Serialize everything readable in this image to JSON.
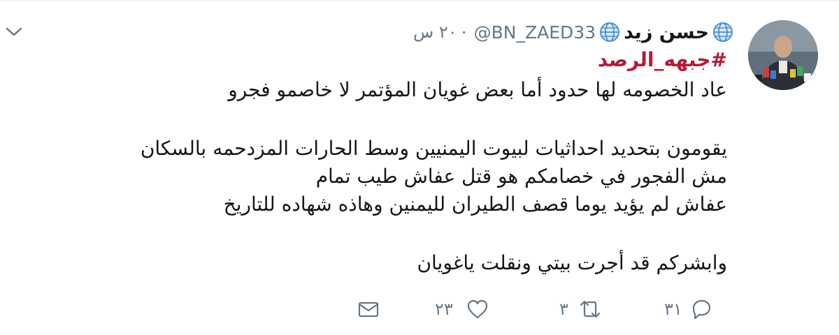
{
  "tweet": {
    "author_name": "حسن زيد",
    "handle": "@BN_ZAED33",
    "separator": "·",
    "time": "٢٠ س",
    "hashtag": "#جبهه_الرصد",
    "lines": [
      "عاد الخصومه لها حدود أما بعض غويان المؤتمر لا خاصمو فجرو",
      "يقومون بتحديد احداثيات لبيوت اليمنيين وسط الحارات المزدحمه بالسكان",
      "مش الفجور في خصامكم هو قتل عفاش طيب تمام",
      "عفاش لم يؤيد يوما قصف الطيران لليمنين وهاذه شهاده للتاريخ",
      "وابشركم قد أجرت بيتي ونقلت ياغويان"
    ]
  },
  "actions": {
    "replies": "٣١",
    "retweets": "٣",
    "likes": "٢٣"
  },
  "colors": {
    "hashtag": "#b61a37",
    "secondary_text": "#657786",
    "icon": "#657786",
    "globe": "#4a90d9"
  },
  "icons": {
    "more": "chevron-down-icon",
    "globe": "globe-icon",
    "reply": "reply-icon",
    "retweet": "retweet-icon",
    "like": "heart-icon",
    "message": "envelope-icon"
  }
}
